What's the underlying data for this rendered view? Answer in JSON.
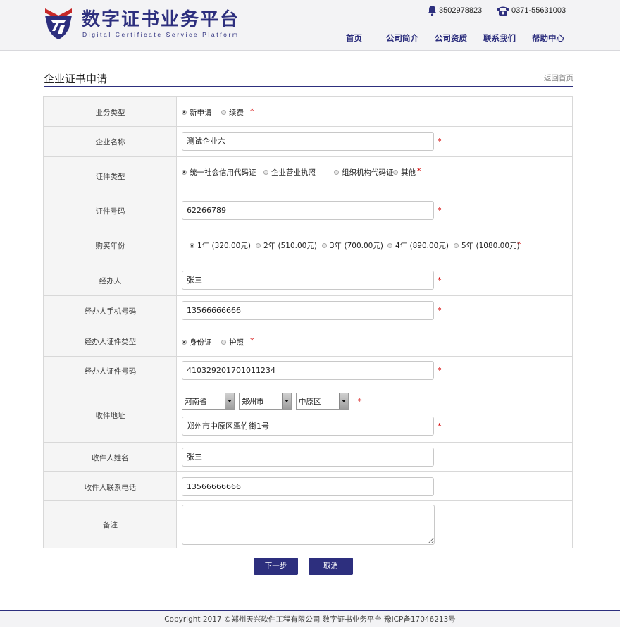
{
  "header": {
    "title": "数字证书业务平台",
    "subtitle": "Digital Certificate Service Platform",
    "phone_mobile": "3502978823",
    "phone_landline": "0371-55631003",
    "nav": [
      "首页",
      "公司简介",
      "公司资质",
      "联系我们",
      "帮助中心"
    ]
  },
  "page": {
    "title": "企业证书申请",
    "back_link": "返回首页"
  },
  "form": {
    "business_type": {
      "label": "业务类型",
      "options": [
        "新申请",
        "续费"
      ],
      "selected": "新申请"
    },
    "company_name": {
      "label": "企业名称",
      "value": "测试企业六"
    },
    "cert_type": {
      "label": "证件类型",
      "options": [
        "统一社会信用代码证",
        "企业营业执照",
        "组织机构代码证",
        "其他"
      ],
      "selected": "统一社会信用代码证"
    },
    "cert_number": {
      "label": "证件号码",
      "value": "62266789"
    },
    "years": {
      "label": "购买年份",
      "options": [
        "1年 (320.00元)",
        "2年 (510.00元)",
        "3年 (700.00元)",
        "4年 (890.00元)",
        "5年 (1080.00元)"
      ],
      "selected": "1年 (320.00元)"
    },
    "agent": {
      "label": "经办人",
      "value": "张三"
    },
    "agent_phone": {
      "label": "经办人手机号码",
      "value": "13566666666"
    },
    "agent_id_type": {
      "label": "经办人证件类型",
      "options": [
        "身份证",
        "护照"
      ],
      "selected": "身份证"
    },
    "agent_id_number": {
      "label": "经办人证件号码",
      "value": "410329201701011234"
    },
    "address": {
      "label": "收件地址",
      "province": "河南省",
      "city": "郑州市",
      "district": "中原区",
      "detail": "郑州市中原区翠竹街1号"
    },
    "recipient_name": {
      "label": "收件人姓名",
      "value": "张三"
    },
    "recipient_phone": {
      "label": "收件人联系电话",
      "value": "13566666666"
    },
    "remark": {
      "label": "备注",
      "value": ""
    },
    "required_mark": "*"
  },
  "buttons": {
    "next": "下一步",
    "cancel": "取消"
  },
  "footer": {
    "text": "Copyright 2017 ©郑州天兴软件工程有限公司 数字证书业务平台 豫ICP备17046213号"
  },
  "colors": {
    "brand": "#2d2f7e",
    "required": "#d40000",
    "label_bg": "#f5f5f5"
  }
}
